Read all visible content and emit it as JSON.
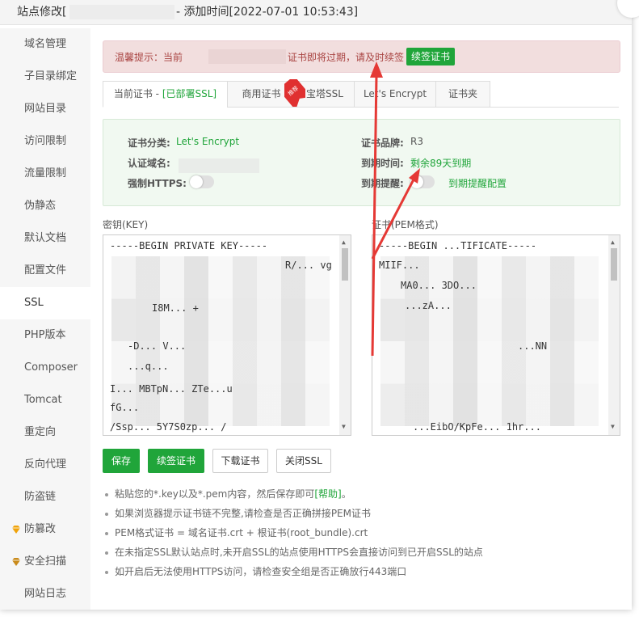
{
  "window": {
    "title_prefix": "站点修改[",
    "title_suffix": "- 添加时间[2022-07-01 10:53:43]"
  },
  "sidebar": {
    "items": [
      {
        "label": "域名管理"
      },
      {
        "label": "子目录绑定"
      },
      {
        "label": "网站目录"
      },
      {
        "label": "访问限制"
      },
      {
        "label": "流量限制"
      },
      {
        "label": "伪静态"
      },
      {
        "label": "默认文档"
      },
      {
        "label": "配置文件"
      },
      {
        "label": "SSL"
      },
      {
        "label": "PHP版本"
      },
      {
        "label": "Composer"
      },
      {
        "label": "Tomcat"
      },
      {
        "label": "重定向"
      },
      {
        "label": "反向代理"
      },
      {
        "label": "防盗链"
      },
      {
        "label": "防篡改"
      },
      {
        "label": "安全扫描"
      },
      {
        "label": "网站日志"
      }
    ],
    "active_label": "SSL",
    "gem_color": "#f0a30a"
  },
  "alert": {
    "text_before": "温馨提示：当前",
    "text_after": "证书即将过期，请及时续签",
    "button": "续签证书"
  },
  "tabs": {
    "current_prefix": "当前证书 - ",
    "current_status": "[已部署SSL]",
    "commercial": "商用证书",
    "commercial_badge": "推荐",
    "baota": "宝塔SSL",
    "letsencrypt": "Let's Encrypt",
    "folder": "证书夹"
  },
  "cert_info": {
    "category_label": "证书分类:",
    "category_value": "Let's Encrypt",
    "domain_label": "认证域名:",
    "https_label": "强制HTTPS:",
    "brand_label": "证书品牌:",
    "brand_value": "R3",
    "expire_label": "到期时间:",
    "expire_value": "剩余89天到期",
    "remind_label": "到期提醒:",
    "remind_link": "到期提醒配置"
  },
  "key_box": {
    "label": "密钥(KEY)",
    "lines": [
      "-----BEGIN PRIVATE KEY-----",
      "R/... vg",
      "...",
      "I8M... +",
      "-D... V...",
      "...q...",
      "I... MBTpN... ZTe...u",
      "fG...",
      "/Ssp... 5Y7S0zp... /"
    ]
  },
  "cert_box": {
    "label": "证书(PEM格式)",
    "lines": [
      "-----BEGIN ...TIFICATE-----",
      "MIIF...",
      "MA0... 3DO...",
      "...zA...",
      "...",
      "...NN",
      "...",
      "...",
      "...EibO/KpFe... 1hr..."
    ]
  },
  "buttons": {
    "save": "保存",
    "renew": "续签证书",
    "download": "下载证书",
    "close_ssl": "关闭SSL"
  },
  "notes": {
    "n1_text": "粘贴您的*.key以及*.pem内容，然后保存即可",
    "n1_link": "[帮助]",
    "n1_end": "。",
    "n2": "如果浏览器提示证书链不完整,请检查是否正确拼接PEM证书",
    "n3": "PEM格式证书 = 域名证书.crt + 根证书(root_bundle).crt",
    "n4": "在未指定SSL默认站点时,未开启SSL的站点使用HTTPS会直接访问到已开启SSL的站点",
    "n5": "如开启后无法使用HTTPS访问，请检查安全组是否正确放行443端口"
  },
  "colors": {
    "brand_green": "#20a53a",
    "alert_red": "#a94442",
    "arrow_red": "#e53935"
  }
}
